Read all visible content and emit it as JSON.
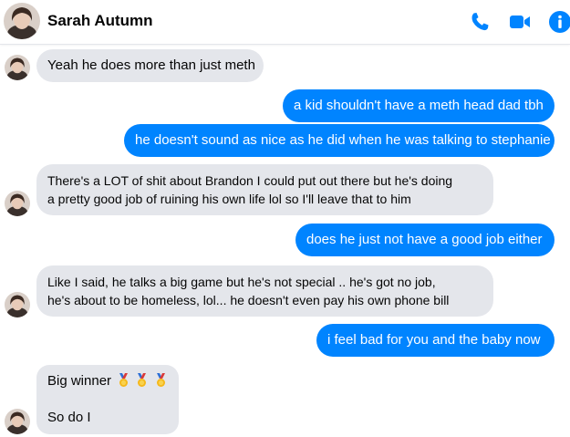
{
  "header": {
    "contact_name": "Sarah Autumn",
    "icons": [
      "phone-icon",
      "video-call-icon",
      "info-icon"
    ]
  },
  "colors": {
    "accent": "#0084ff",
    "incoming_bubble": "#e4e6eb",
    "text": "#050505"
  },
  "messages": [
    {
      "direction": "incoming",
      "lines": [
        "Yeah he does more than just meth"
      ]
    },
    {
      "direction": "outgoing",
      "lines": [
        "a kid shouldn't have a meth head dad tbh"
      ]
    },
    {
      "direction": "outgoing",
      "lines": [
        "he doesn't sound as nice as he did when he was talking to stephanie"
      ]
    },
    {
      "direction": "incoming",
      "lines": [
        "There's a LOT of shit about Brandon I could put out there but he's doing",
        "a pretty good job of ruining his own life lol so I'll leave that to him"
      ]
    },
    {
      "direction": "outgoing",
      "lines": [
        "does he just not have a good job either"
      ]
    },
    {
      "direction": "incoming",
      "lines": [
        "Like I said, he talks a big game but he's not special .. he's got no job,",
        "he's about to be homeless, lol... he doesn't even pay his own phone bill"
      ]
    },
    {
      "direction": "outgoing",
      "lines": [
        "i feel bad for you and the baby now"
      ]
    },
    {
      "direction": "incoming",
      "lines": [
        "Big winner",
        "So do I"
      ],
      "emoji": [
        "medal-icon",
        "medal-icon",
        "medal-icon"
      ]
    }
  ]
}
